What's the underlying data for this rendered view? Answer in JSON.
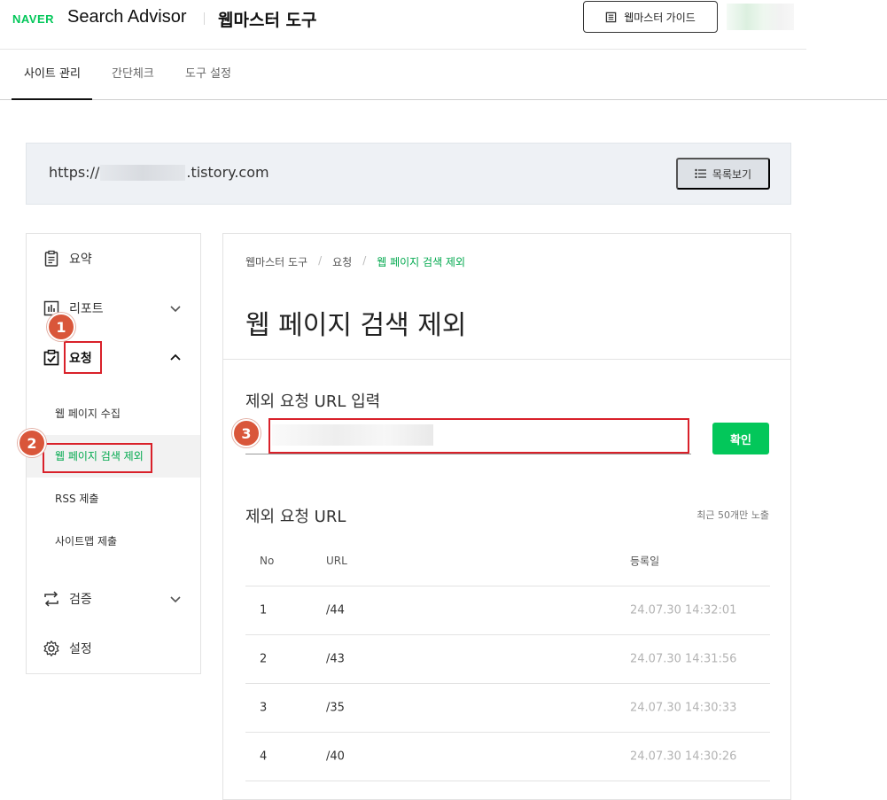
{
  "header": {
    "naver": "NAVER",
    "brand": "Search Advisor",
    "tool_title": "웹마스터 도구",
    "guide_button": "웹마스터 가이드"
  },
  "tabs": [
    {
      "label": "사이트 관리",
      "active": true
    },
    {
      "label": "간단체크",
      "active": false
    },
    {
      "label": "도구 설정",
      "active": false
    }
  ],
  "site": {
    "url_prefix": "https://",
    "url_suffix": ".tistory.com",
    "list_button": "목록보기"
  },
  "sidebar": {
    "items": [
      {
        "label": "요약",
        "icon": "clipboard-icon"
      },
      {
        "label": "리포트",
        "icon": "chart-icon"
      },
      {
        "label": "요청",
        "icon": "checklist-icon"
      },
      {
        "label": "검증",
        "icon": "repeat-icon"
      },
      {
        "label": "설정",
        "icon": "gear-icon"
      }
    ],
    "sub_items": [
      {
        "label": "웹 페이지 수집"
      },
      {
        "label": "웹 페이지 검색 제외"
      },
      {
        "label": "RSS 제출"
      },
      {
        "label": "사이트맵 제출"
      }
    ]
  },
  "main": {
    "breadcrumb": [
      "웹마스터 도구",
      "요청",
      "웹 페이지 검색 제외"
    ],
    "page_title": "웹 페이지 검색 제외",
    "input_section": "제외 요청 URL 입력",
    "confirm_button": "확인",
    "list_section": "제외 요청 URL",
    "recent_note": "최근 50개만 노출",
    "table": {
      "headers": [
        "No",
        "URL",
        "등록일"
      ],
      "rows": [
        {
          "no": "1",
          "url": "/44",
          "date": "24.07.30 14:32:01"
        },
        {
          "no": "2",
          "url": "/43",
          "date": "24.07.30 14:31:56"
        },
        {
          "no": "3",
          "url": "/35",
          "date": "24.07.30 14:30:33"
        },
        {
          "no": "4",
          "url": "/40",
          "date": "24.07.30 14:30:26"
        }
      ]
    }
  },
  "annotations": {
    "badge1": "1",
    "badge2": "2",
    "badge3": "3",
    "color": "#d9212a"
  }
}
